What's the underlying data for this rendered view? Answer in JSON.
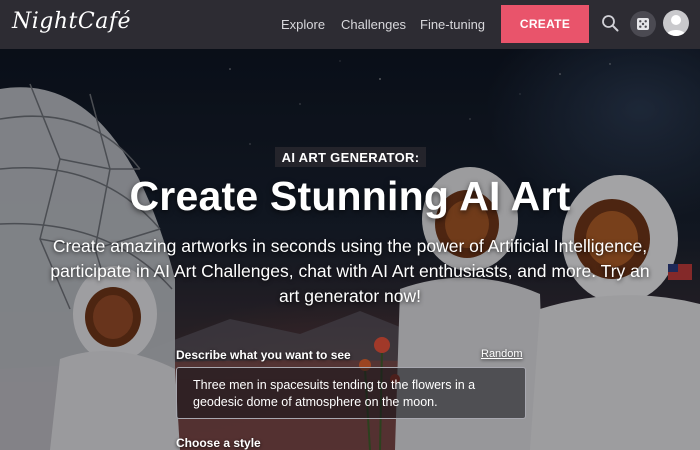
{
  "nav": {
    "logo": "NightCafé",
    "links": [
      "Explore",
      "Challenges",
      "Fine-tuning"
    ],
    "create_label": "CREATE"
  },
  "icons": {
    "search": "search-icon",
    "dice": "dice-icon",
    "avatar": "avatar-icon"
  },
  "hero": {
    "badge": "AI ART GENERATOR:",
    "title": "Create Stunning AI Art",
    "subtitle": "Create amazing artworks in seconds using the power of Artificial Intelligence, participate in AI Art Challenges, chat with AI Art enthusiasts, and more. Try an art generator now!"
  },
  "prompt": {
    "label": "Describe what you want to see",
    "random_label": "Random",
    "value": "Three men in spacesuits tending to the flowers in a geodesic dome of atmosphere on the moon."
  },
  "style": {
    "label": "Choose a style"
  },
  "colors": {
    "nav_bg": "#2d2c33",
    "accent": "#e9546b"
  }
}
